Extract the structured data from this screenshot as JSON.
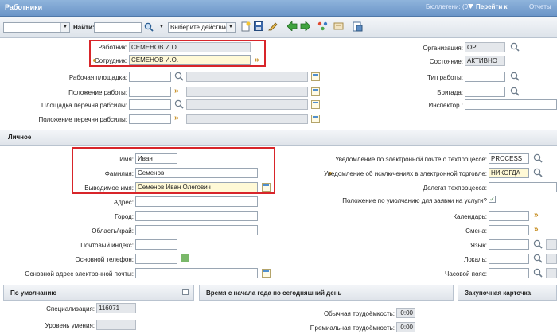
{
  "titlebar": {
    "title": "Работники",
    "bulletins": "Бюллетени: (0)",
    "goto": "Перейти к",
    "reports": "Отчеты"
  },
  "toolbar": {
    "find_label": "Найти:",
    "find_value": "",
    "action_select": "Выберите действие"
  },
  "top": {
    "worker_label": "Работник:",
    "worker_value": "СЕМЕНОВ И.О.",
    "employee_label": "Сотрудник:",
    "employee_value": "СЕМЕНОВ И.О.",
    "workplace_label": "Рабочая площадка:",
    "work_position_label": "Положение работы:",
    "workplace_list_label": "Площадка перечня рабсилы:",
    "position_list_label": "Положение перечня рабсилы:",
    "org_label": "Организация:",
    "org_value": "ОРГ",
    "state_label": "Состояние:",
    "state_value": "АКТИВНО",
    "work_type_label": "Тип работы:",
    "crew_label": "Бригада:",
    "inspector_label": "Инспектор :"
  },
  "personal": {
    "section_title": "Личное",
    "first_name_label": "Имя:",
    "first_name_value": "Иван",
    "last_name_label": "Фамилия:",
    "last_name_value": "Семенов",
    "display_name_label": "Выводимое имя:",
    "display_name_value": "Семенов Иван Олегович",
    "address_label": "Адрес:",
    "city_label": "Город:",
    "region_label": "Область/край:",
    "zip_label": "Почтовый индекс:",
    "phone_label": "Основной телефон:",
    "email_label": "Основной адрес электронной почты:",
    "notify_process_label": "Уведомление по электронной почте о техпроцессе:",
    "notify_process_value": "PROCESS",
    "notify_exc_label": "Уведомление об исключениях в электронной торговле:",
    "notify_exc_value": "НИКОГДА",
    "delegate_label": "Делегат техпроцесса:",
    "default_pos_label": "Положение по умолчанию для заявки на услуги?",
    "calendar_label": "Календарь:",
    "shift_label": "Смена:",
    "language_label": "Язык:",
    "locale_label": "Локаль:",
    "timezone_label": "Часовой пояс:"
  },
  "defaults": {
    "title": "По умолчанию",
    "spec_label": "Специализация:",
    "spec_value": "116071",
    "skill_label": "Уровень умения:"
  },
  "ytd": {
    "title": "Время с начала года по сегодняшний день",
    "regular_label": "Обычная трудоёмкость:",
    "regular_value": "0:00",
    "premium_label": "Премиальная трудоёмкость:",
    "premium_value": "0:00"
  },
  "purchase": {
    "title": "Закупочная карточка"
  },
  "colors": {
    "titlebar": "#6a94c8",
    "highlight": "#d8252a",
    "readonly": "#e4e7eb"
  }
}
